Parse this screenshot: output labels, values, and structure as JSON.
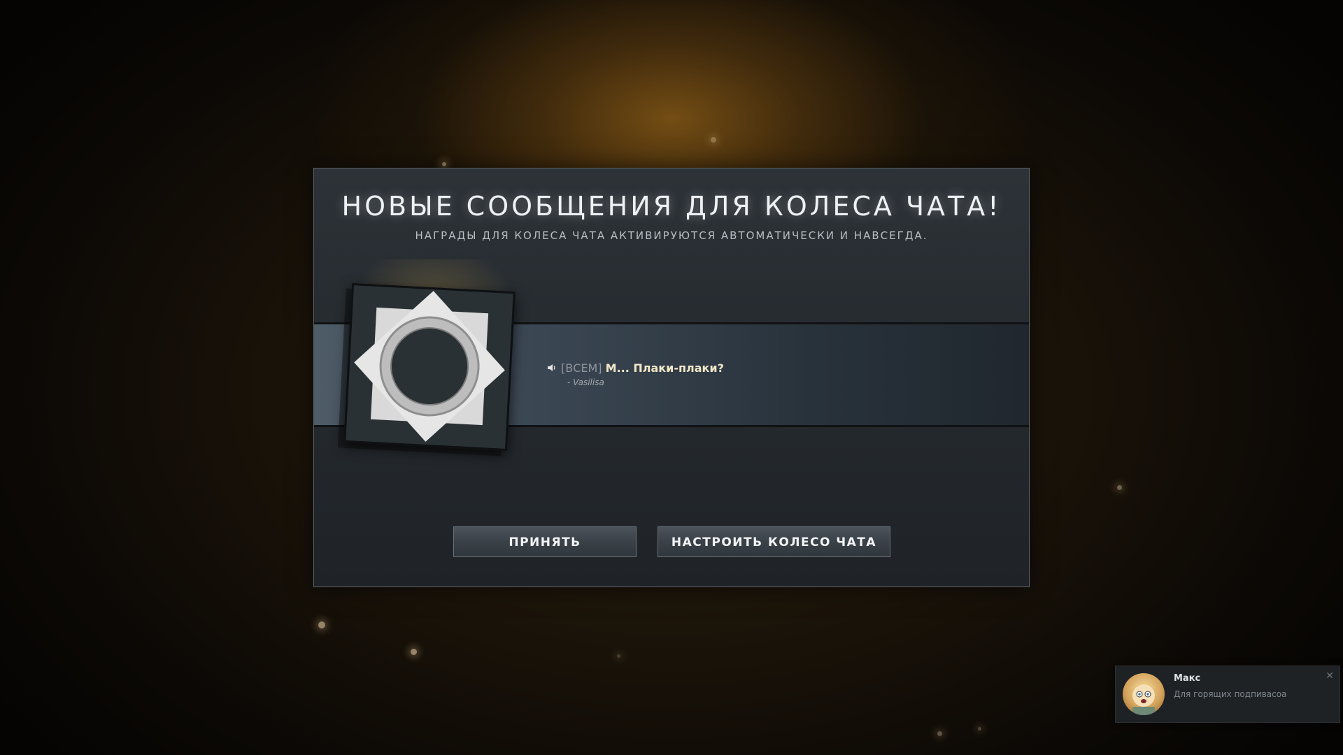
{
  "dialog": {
    "title": "НОВЫЕ СООБЩЕНИЯ ДЛЯ КОЛЕСА ЧАТА!",
    "subtitle": "НАГРАДЫ ДЛЯ КОЛЕСА ЧАТА АКТИВИРУЮТСЯ АВТОМАТИЧЕСКИ И НАВСЕГДА.",
    "icon": "chat-wheel-sun-icon",
    "chat_line": {
      "icon": "speaker-icon",
      "tag": "[ВСЕМ]",
      "message": "М... Плаки-плаки?",
      "author": "- Vasilisa"
    },
    "buttons": {
      "accept": "ПРИНЯТЬ",
      "configure": "НАСТРОИТЬ КОЛЕСО ЧАТА"
    }
  },
  "notification": {
    "name": "Макс",
    "text": "Для горящих подпивасоа",
    "close_icon": "close-icon"
  },
  "colors": {
    "accent_glow": "#7a5218",
    "dialog_bg": "#262b30",
    "message_text": "#f2e8c8"
  }
}
